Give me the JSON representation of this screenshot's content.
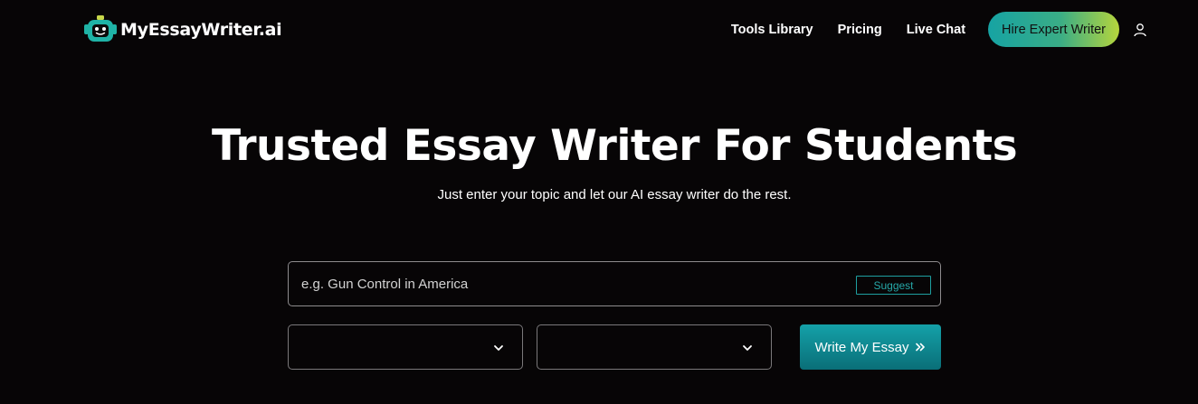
{
  "brand": {
    "name": "MyEssayWriter.ai"
  },
  "nav": {
    "links": [
      "Tools Library",
      "Pricing",
      "Live Chat"
    ],
    "cta_label": "Hire Expert Writer",
    "user_icon": "user-icon"
  },
  "hero": {
    "title": "Trusted Essay Writer For Students",
    "subtitle": "Just enter your topic and let our AI essay writer do the rest."
  },
  "form": {
    "topic_placeholder": "e.g. Gun Control in America",
    "topic_value": "",
    "suggest_label": "Suggest",
    "select_one_value": "",
    "select_two_value": "",
    "submit_label": "Write My Essay",
    "submit_icon": "double-chevron-right-icon"
  },
  "colors": {
    "background": "#070506",
    "accent": "#14a1a8",
    "cta_gradient_start": "#16a3a3",
    "cta_gradient_end": "#b6d53c"
  }
}
